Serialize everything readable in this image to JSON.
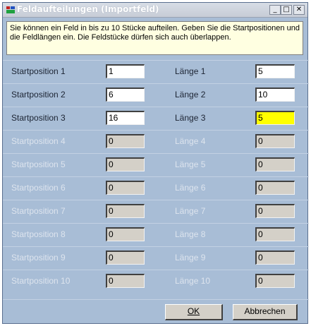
{
  "window": {
    "title": "Feldaufteilungen (Importfeld)",
    "minimize_glyph": "_",
    "maximize_glyph": "□",
    "close_glyph": "✕"
  },
  "info_text": "Sie können ein Feld in bis zu 10 Stücke aufteilen. Geben Sie die Startpositionen und die Feldlängen ein. Die Feldstücke dürfen sich auch überlappen.",
  "rows": [
    {
      "start_label": "Startposition 1",
      "start_value": "1",
      "length_label": "Länge 1",
      "length_value": "5",
      "enabled": true
    },
    {
      "start_label": "Startposition 2",
      "start_value": "6",
      "length_label": "Länge 2",
      "length_value": "10",
      "enabled": true
    },
    {
      "start_label": "Startposition 3",
      "start_value": "16",
      "length_label": "Länge 3",
      "length_value": "5",
      "enabled": true,
      "highlight": true
    },
    {
      "start_label": "Startposition 4",
      "start_value": "0",
      "length_label": "Länge 4",
      "length_value": "0",
      "enabled": false
    },
    {
      "start_label": "Startposition 5",
      "start_value": "0",
      "length_label": "Länge 5",
      "length_value": "0",
      "enabled": false
    },
    {
      "start_label": "Startposition 6",
      "start_value": "0",
      "length_label": "Länge 6",
      "length_value": "0",
      "enabled": false
    },
    {
      "start_label": "Startposition 7",
      "start_value": "0",
      "length_label": "Länge 7",
      "length_value": "0",
      "enabled": false
    },
    {
      "start_label": "Startposition 8",
      "start_value": "0",
      "length_label": "Länge 8",
      "length_value": "0",
      "enabled": false
    },
    {
      "start_label": "Startposition 9",
      "start_value": "0",
      "length_label": "Länge 9",
      "length_value": "0",
      "enabled": false
    },
    {
      "start_label": "Startposition 10",
      "start_value": "0",
      "length_label": "Länge 10",
      "length_value": "0",
      "enabled": false
    }
  ],
  "buttons": {
    "ok_label": "OK",
    "cancel_label": "Abbrechen"
  },
  "colors": {
    "highlight": "#ffff00",
    "panel": "#a8bdd6"
  }
}
